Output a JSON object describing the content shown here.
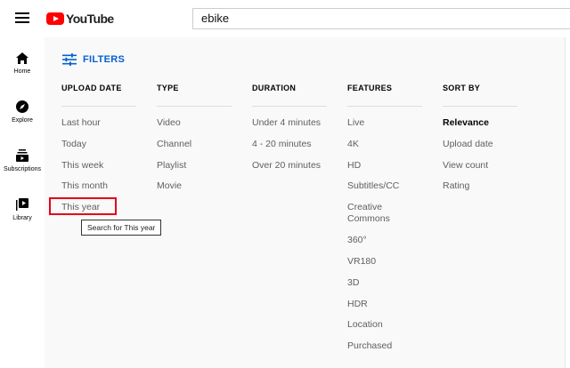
{
  "header": {
    "logo_text": "YouTube",
    "search_value": "ebike"
  },
  "sidebar": {
    "items": [
      {
        "label": "Home",
        "icon": "home-icon"
      },
      {
        "label": "Explore",
        "icon": "compass-icon"
      },
      {
        "label": "Subscriptions",
        "icon": "subscriptions-icon"
      },
      {
        "label": "Library",
        "icon": "library-icon"
      }
    ]
  },
  "filters": {
    "toggle_label": "FILTERS",
    "columns": [
      {
        "heading": "UPLOAD DATE",
        "options": [
          "Last hour",
          "Today",
          "This week",
          "This month",
          "This year"
        ]
      },
      {
        "heading": "TYPE",
        "options": [
          "Video",
          "Channel",
          "Playlist",
          "Movie"
        ]
      },
      {
        "heading": "DURATION",
        "options": [
          "Under 4 minutes",
          "4 - 20 minutes",
          "Over 20 minutes"
        ]
      },
      {
        "heading": "FEATURES",
        "options": [
          "Live",
          "4K",
          "HD",
          "Subtitles/CC",
          "Creative",
          "Commons",
          "360°",
          "VR180",
          "3D",
          "HDR",
          "Location",
          "Purchased"
        ]
      },
      {
        "heading": "SORT BY",
        "options": [
          "Relevance",
          "Upload date",
          "View count",
          "Rating"
        ]
      }
    ],
    "selected_sort": "Relevance"
  },
  "tooltip": {
    "text": "Search for This year"
  },
  "colors": {
    "accent": "#065fd4",
    "brand": "#ff0000",
    "highlight": "#e3001b"
  }
}
